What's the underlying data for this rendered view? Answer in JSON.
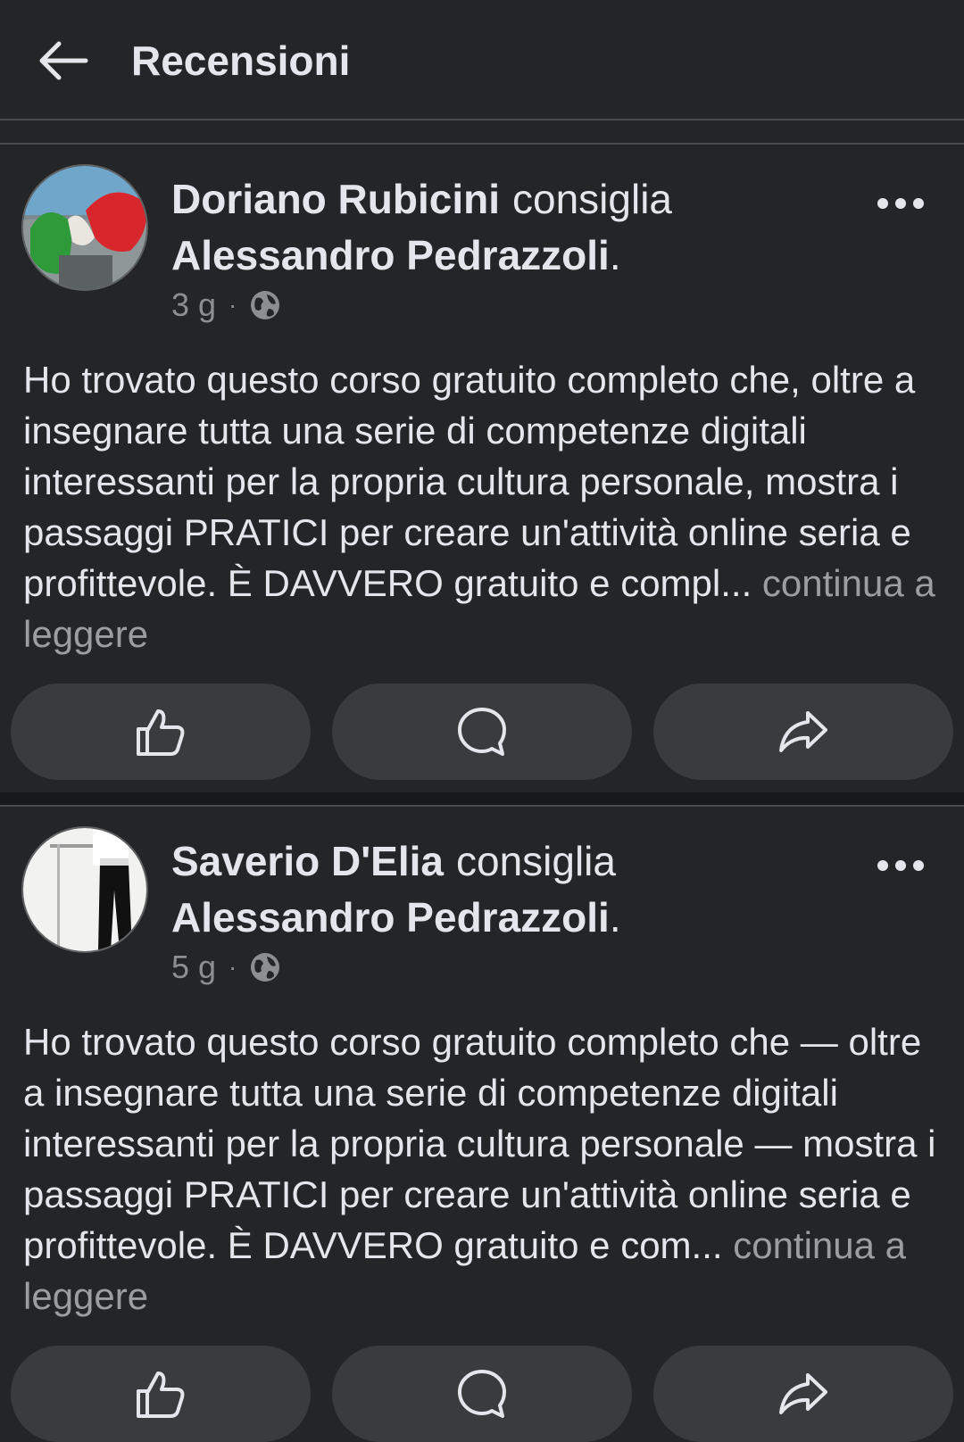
{
  "header": {
    "title": "Recensioni",
    "back_icon": "arrow-left-icon"
  },
  "posts": [
    {
      "author": "Doriano Rubicini",
      "verb": "consiglia",
      "target": "Alessandro Pedrazzoli",
      "target_suffix": ".",
      "time": "3 g",
      "separator": "·",
      "privacy_icon": "globe-icon",
      "text": "Ho trovato questo corso gratuito completo che, oltre a insegnare tutta una serie di competenze digitali interessanti per la propria cultura personale, mostra i passaggi PRATICI per creare un'attività online seria e profittevole. È DAVVERO gratuito e compl...",
      "more_label": " continua a leggere",
      "actions": [
        "like-icon",
        "comment-icon",
        "share-icon"
      ]
    },
    {
      "author": "Saverio D'Elia",
      "verb": "consiglia",
      "target": "Alessandro Pedrazzoli",
      "target_suffix": ".",
      "time": "5 g",
      "separator": "·",
      "privacy_icon": "globe-icon",
      "text": "Ho trovato questo corso gratuito completo che — oltre a insegnare tutta una serie di competenze digitali interessanti per la propria cultura personale — mostra i passaggi PRATICI per creare un'attività online seria e profittevole. È DAVVERO gratuito e com...",
      "more_label": " continua a leggere",
      "actions": [
        "like-icon",
        "comment-icon",
        "share-icon"
      ]
    }
  ],
  "colors": {
    "background": "#242526",
    "button_bg": "#3a3b3c",
    "text_primary": "#e4e6eb",
    "text_secondary": "#8c8e91"
  }
}
